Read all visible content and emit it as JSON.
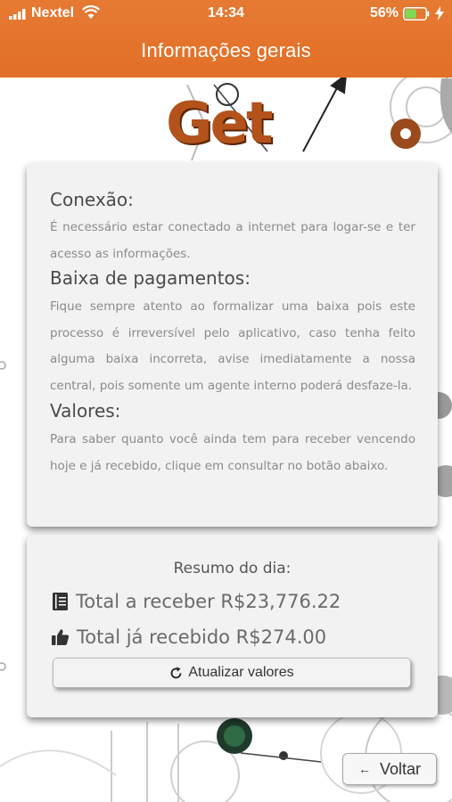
{
  "status_bar": {
    "carrier": "Nextel",
    "time": "14:34",
    "battery_percent": "56%",
    "battery_level": 0.56,
    "icons": [
      "signal-icon",
      "wifi-icon",
      "battery-icon",
      "charging-icon"
    ]
  },
  "header": {
    "title": "Informações gerais"
  },
  "logo_text": "Get",
  "info": {
    "sections": [
      {
        "heading": "Conexão:",
        "text": "É necessário estar conectado a internet para logar-se e ter acesso as informações."
      },
      {
        "heading": "Baixa de pagamentos:",
        "text": "Fique sempre atento ao formalizar uma baixa pois este processo é irreversível pelo aplicativo, caso tenha feito alguma baixa incorreta, avise imediatamente a nossa central, pois somente um agente interno poderá desfaze-la."
      },
      {
        "heading": "Valores:",
        "text": "Para saber quanto você ainda tem para receber vencendo hoje e já recebido, clique em consultar no botão abaixo."
      }
    ]
  },
  "summary": {
    "title": "Resumo do dia:",
    "to_receive": "Total a receber R$23,776.22",
    "received": "Total já recebido R$274.00",
    "update_label": "Atualizar valores"
  },
  "footer": {
    "back_label": "Voltar"
  },
  "colors": {
    "header": "#e26f27",
    "card": "#f2f2f2",
    "logo": "#b4521c"
  }
}
